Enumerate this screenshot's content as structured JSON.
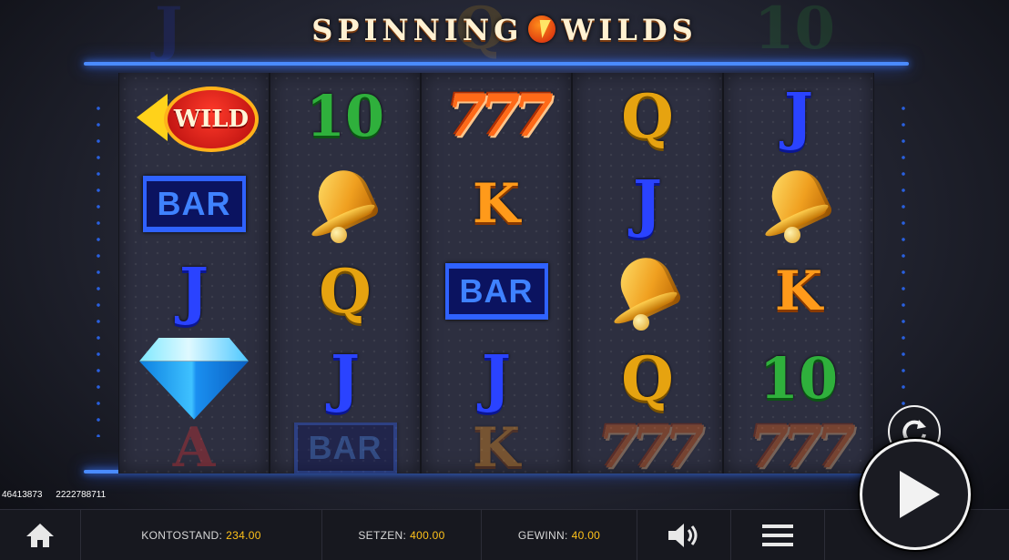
{
  "title": {
    "left": "SPINNING",
    "right": "WILDS"
  },
  "background_symbols": [
    "J",
    "Q",
    "10"
  ],
  "reels": [
    [
      "wild",
      "bar",
      "J",
      "diamond"
    ],
    [
      "10",
      "bell",
      "Q",
      "J"
    ],
    [
      "777",
      "K",
      "bar",
      "J"
    ],
    [
      "Q",
      "J",
      "bell",
      "Q"
    ],
    [
      "J",
      "bell",
      "K",
      "10"
    ]
  ],
  "partial_next_row": [
    "A",
    "bar",
    "K",
    "777",
    "777"
  ],
  "symbol_labels": {
    "wild": "WILD",
    "bar": "BAR",
    "777": "777"
  },
  "ids": {
    "left": "46413873",
    "right": "2222788711"
  },
  "footer": {
    "balance_label": "KONTOSTAND:",
    "balance_value": "234.00",
    "bet_label": "SETZEN:",
    "bet_value": "400.00",
    "win_label": "GEWINN:",
    "win_value": "40.00"
  },
  "icons": {
    "home": "home-icon",
    "sound": "speaker-icon",
    "menu": "hamburger-menu-icon",
    "autoplay": "refresh-icon",
    "spin": "play-icon"
  },
  "colors": {
    "neon": "#4a8bff",
    "value_accent": "#ffc21a",
    "footer_bg": "#17181f"
  }
}
